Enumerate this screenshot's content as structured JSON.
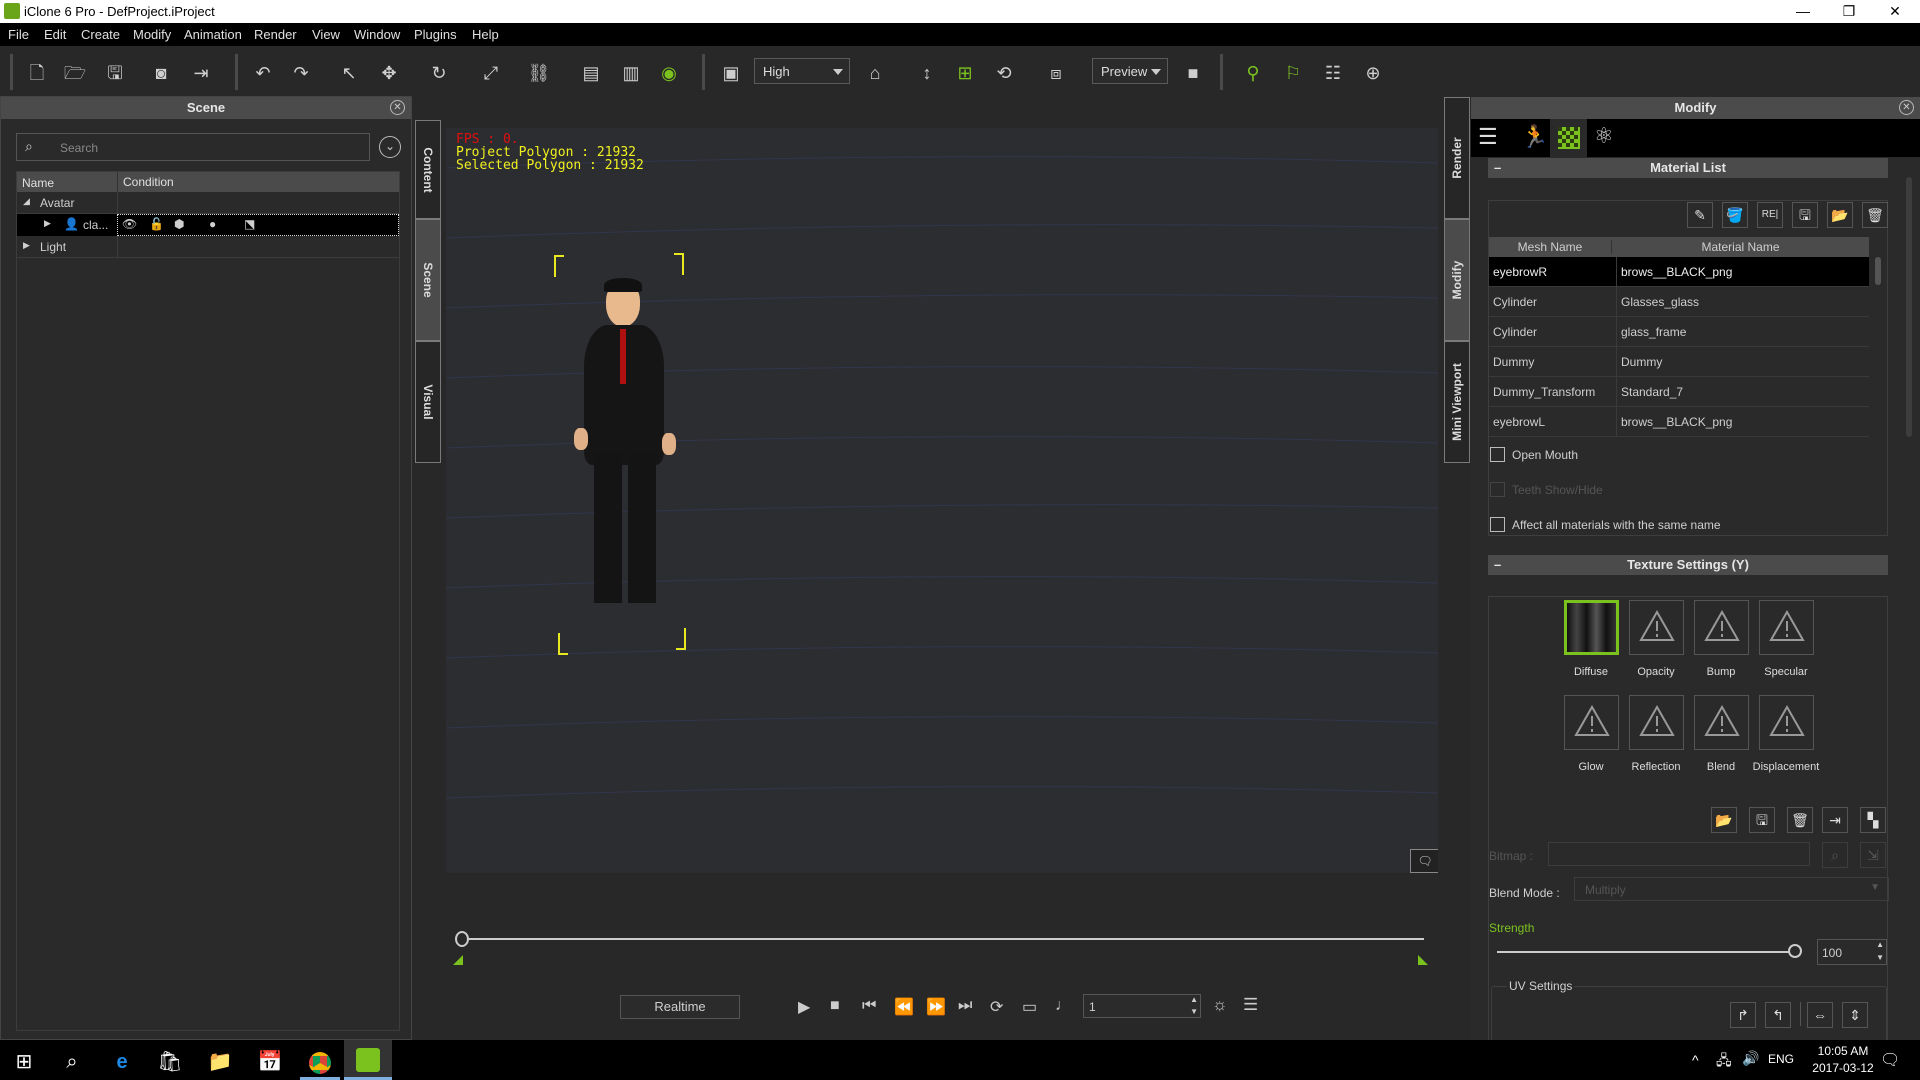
{
  "window": {
    "title": "iClone 6 Pro - DefProject.iProject",
    "minimize": "—",
    "maximize": "❐",
    "close": "✕"
  },
  "menu": [
    "File",
    "Edit",
    "Create",
    "Modify",
    "Animation",
    "Render",
    "View",
    "Window",
    "Plugins",
    "Help"
  ],
  "toolbar": {
    "quality": "High",
    "render_mode": "Preview"
  },
  "scene_panel": {
    "title": "Scene",
    "search_placeholder": "Search",
    "columns": [
      "Name",
      "Condition"
    ],
    "tree": [
      {
        "label": "Avatar",
        "expanded": true
      },
      {
        "label": "cla...",
        "selected": true
      },
      {
        "label": "Light",
        "expanded": false
      }
    ]
  },
  "left_tabs": [
    "Content",
    "Scene",
    "Visual"
  ],
  "right_tabs": [
    "Render",
    "Modify",
    "Mini Viewport"
  ],
  "viewport": {
    "fps": "FPS : 0.",
    "project_polygon": "Project Polygon : 21932",
    "selected_polygon": "Selected Polygon : 21932"
  },
  "timeline": {
    "realtime_label": "Realtime",
    "frame": "1"
  },
  "modify_panel": {
    "title": "Modify",
    "material_list": {
      "title": "Material List",
      "columns": [
        "Mesh Name",
        "Material Name"
      ],
      "rows": [
        {
          "mesh": "eyebrowR",
          "material": "brows__BLACK_png",
          "selected": true
        },
        {
          "mesh": "Cylinder",
          "material": "Glasses_glass"
        },
        {
          "mesh": "Cylinder",
          "material": "glass_frame"
        },
        {
          "mesh": "Dummy",
          "material": "Dummy"
        },
        {
          "mesh": "Dummy_Transform",
          "material": "Standard_7"
        },
        {
          "mesh": "eyebrowL",
          "material": "brows__BLACK_png"
        }
      ],
      "open_mouth": "Open Mouth",
      "teeth": "Teeth Show/Hide",
      "affect_all": "Affect all materials with the same name"
    },
    "texture_settings": {
      "title": "Texture Settings  (Y)",
      "channels": [
        "Diffuse",
        "Opacity",
        "Bump",
        "Specular",
        "Glow",
        "Reflection",
        "Blend",
        "Displacement"
      ],
      "bitmap_label": "Bitmap :",
      "blend_mode_label": "Blend Mode :",
      "blend_mode_value": "Multiply",
      "strength_label": "Strength",
      "strength_value": "100",
      "strength_fraction": 1.0,
      "uv_settings": "UV Settings"
    }
  },
  "taskbar": {
    "time": "10:05 AM",
    "date": "2017-03-12",
    "lang": "ENG"
  },
  "colors": {
    "accent": "#7bc21f",
    "fps": "#e01010",
    "stats": "#f0f020"
  }
}
